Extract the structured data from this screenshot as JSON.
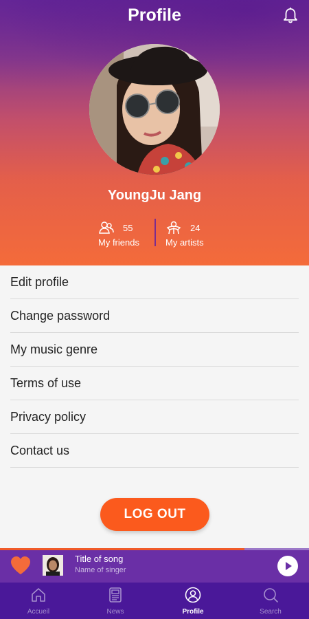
{
  "header": {
    "title": "Profile",
    "bell_icon": "bell-icon"
  },
  "profile": {
    "name": "YoungJu Jang",
    "friends_count": "55",
    "friends_label": "My friends",
    "artists_count": "24",
    "artists_label": "My artists"
  },
  "menu": {
    "items": [
      {
        "label": "Edit profile"
      },
      {
        "label": "Change password"
      },
      {
        "label": "My music genre"
      },
      {
        "label": "Terms of use"
      },
      {
        "label": "Privacy policy"
      },
      {
        "label": "Contact us"
      }
    ]
  },
  "logout_label": "LOG OUT",
  "player": {
    "song_title": "Title of song",
    "singer": "Name of singer",
    "progress": 0.79
  },
  "tabs": [
    {
      "label": "Accueil",
      "icon": "home-icon"
    },
    {
      "label": "News",
      "icon": "news-icon"
    },
    {
      "label": "Profile",
      "icon": "user-icon",
      "active": true
    },
    {
      "label": "Search",
      "icon": "search-icon"
    }
  ],
  "colors": {
    "accent": "#fb5a1d",
    "player_bg": "#6a2fa6",
    "tabbar_bg": "#4a1899"
  }
}
